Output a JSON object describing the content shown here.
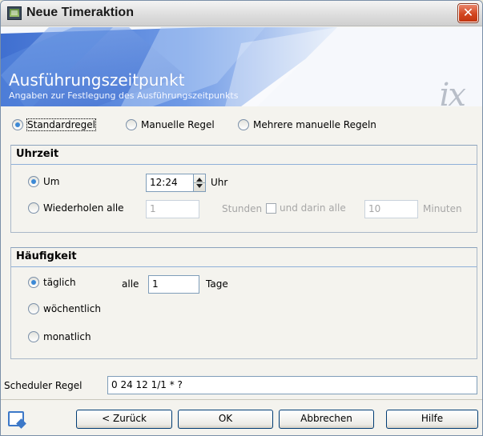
{
  "window": {
    "title": "Neue Timeraktion",
    "close_glyph": "✕"
  },
  "banner": {
    "title": "Ausführungszeitpunkt",
    "subtitle": "Angaben zur Festlegung des Ausführungszeitpunkts",
    "logo_text": "ix"
  },
  "modes": [
    {
      "label": "Standardregel",
      "selected": true
    },
    {
      "label": "Manuelle Regel",
      "selected": false
    },
    {
      "label": "Mehrere manuelle Regeln",
      "selected": false
    }
  ],
  "uhrzeit": {
    "heading": "Uhrzeit",
    "um_label": "Um",
    "time_value": "12:24",
    "uhr_label": "Uhr",
    "repeat_label": "Wiederholen alle",
    "repeat_value": "1",
    "stunden_label": "Stunden",
    "darin_label": "und darin alle",
    "darin_value": "10",
    "minuten_label": "Minuten"
  },
  "haeufigkeit": {
    "heading": "Häufigkeit",
    "daily_label": "täglich",
    "alle_label": "alle",
    "days_value": "1",
    "tage_label": "Tage",
    "weekly_label": "wöchentlich",
    "monthly_label": "monatlich"
  },
  "scheduler": {
    "label": "Scheduler Regel",
    "value": "0 24 12 1/1 * ?"
  },
  "buttons": {
    "back": "< Zurück",
    "ok": "OK",
    "cancel": "Abbrechen",
    "help": "Hilfe"
  },
  "icons": {
    "app": "timer-app-icon",
    "close": "close-icon",
    "help": "help-icon",
    "spin": "spin-updown-icon"
  },
  "colors": {
    "banner_blue": "#4a7fd6",
    "close_red": "#d2461f",
    "radio_selected": "#3c89d6"
  }
}
